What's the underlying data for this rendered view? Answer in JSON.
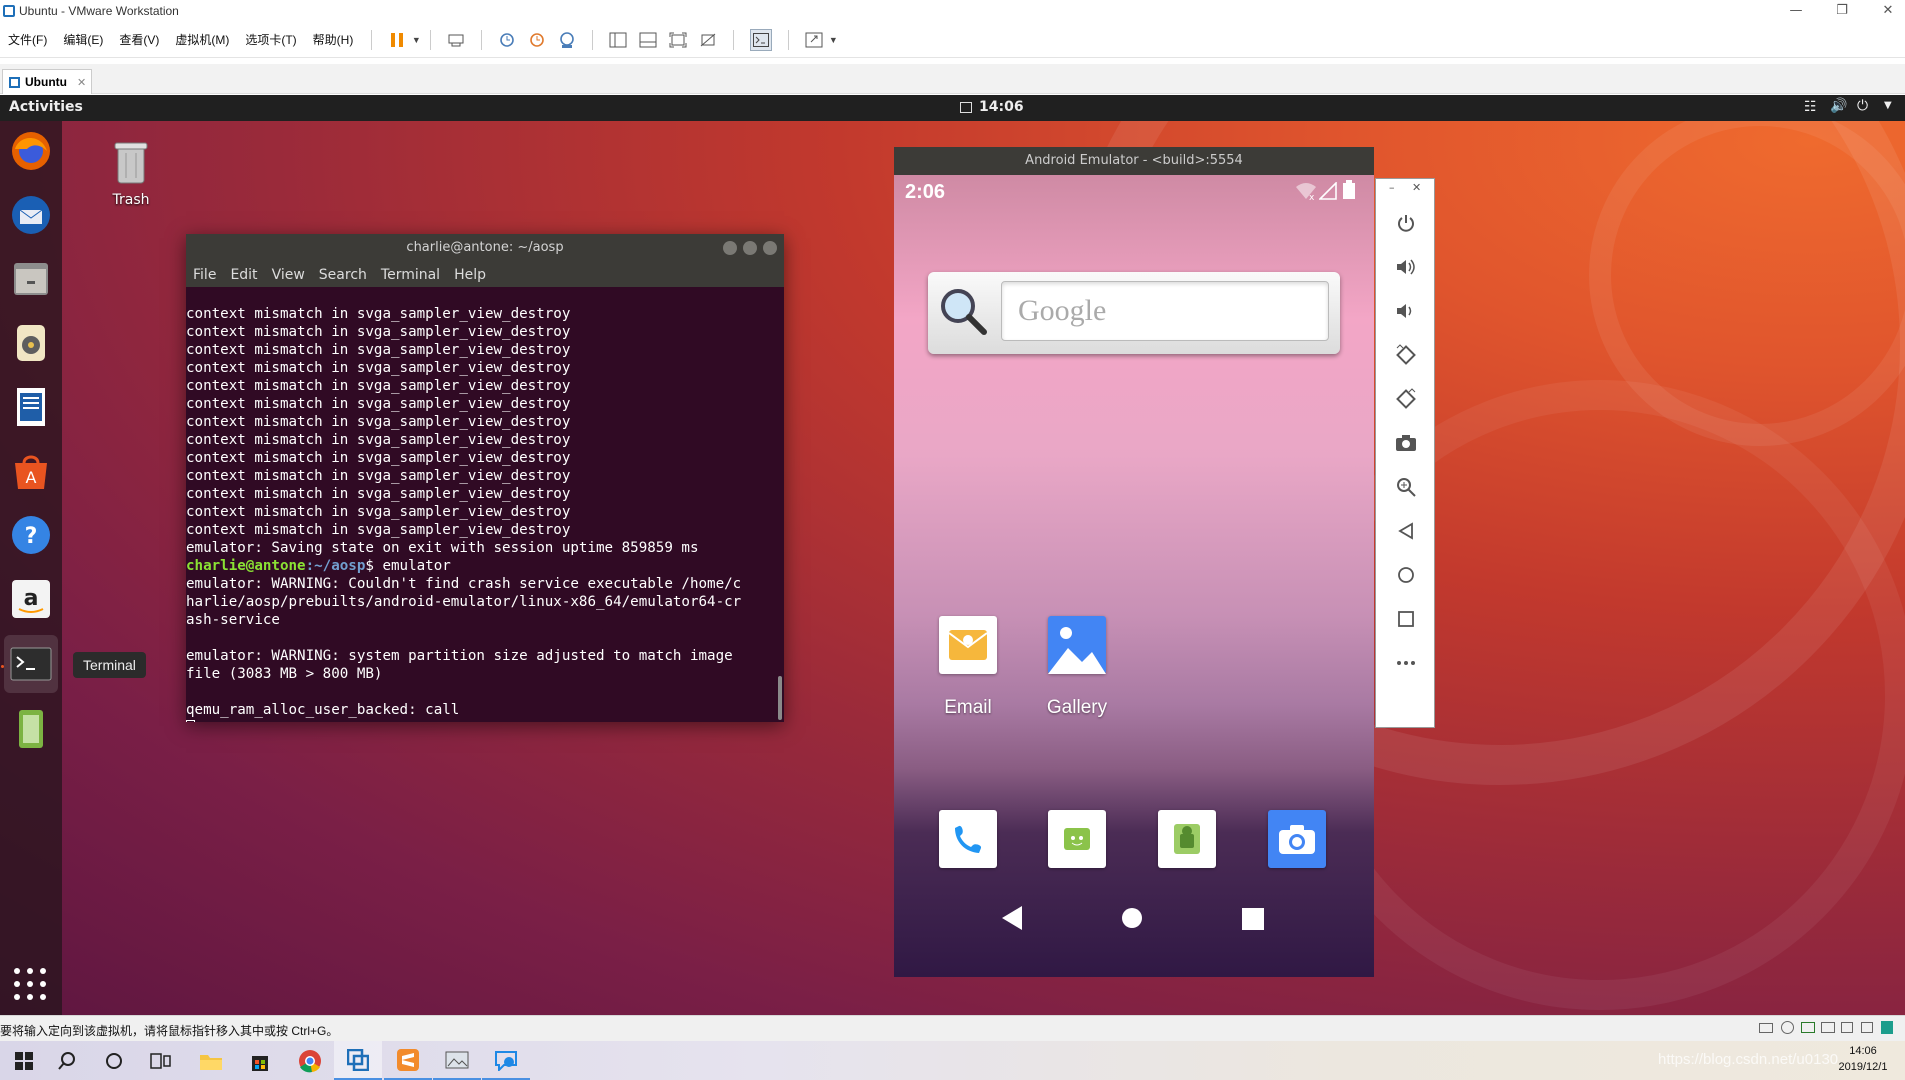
{
  "window": {
    "title": "Ubuntu - VMware Workstation",
    "menus": [
      "文件(F)",
      "编辑(E)",
      "查看(V)",
      "虚拟机(M)",
      "选项卡(T)",
      "帮助(H)"
    ],
    "tab_label": "Ubuntu"
  },
  "ubuntu": {
    "activities": "Activities",
    "clock": "14:06",
    "desktop_icon_label": "Trash",
    "dock_tooltip": "Terminal"
  },
  "terminal": {
    "title": "charlie@antone: ~/aosp",
    "menu": [
      "File",
      "Edit",
      "View",
      "Search",
      "Terminal",
      "Help"
    ],
    "lines": [
      "context mismatch in svga_sampler_view_destroy",
      "context mismatch in svga_sampler_view_destroy",
      "context mismatch in svga_sampler_view_destroy",
      "context mismatch in svga_sampler_view_destroy",
      "context mismatch in svga_sampler_view_destroy",
      "context mismatch in svga_sampler_view_destroy",
      "context mismatch in svga_sampler_view_destroy",
      "context mismatch in svga_sampler_view_destroy",
      "context mismatch in svga_sampler_view_destroy",
      "context mismatch in svga_sampler_view_destroy",
      "context mismatch in svga_sampler_view_destroy",
      "context mismatch in svga_sampler_view_destroy",
      "context mismatch in svga_sampler_view_destroy",
      "emulator: Saving state on exit with session uptime 859859 ms"
    ],
    "prompt_user": "charlie@antone",
    "prompt_path": ":~/aosp",
    "prompt_cmd": "$ emulator",
    "output": [
      "emulator: WARNING: Couldn't find crash service executable /home/c",
      "harlie/aosp/prebuilts/android-emulator/linux-x86_64/emulator64-cr",
      "ash-service",
      "",
      "emulator: WARNING: system partition size adjusted to match image",
      "file (3083 MB > 800 MB)",
      "",
      "qemu_ram_alloc_user_backed: call"
    ]
  },
  "emulator": {
    "title": "Android Emulator - <build>:5554",
    "time": "2:06",
    "search_placeholder": "Google",
    "apps": [
      {
        "label": "Email"
      },
      {
        "label": "Gallery"
      }
    ]
  },
  "vm_status": {
    "hint": "要将输入定向到该虚拟机，请将鼠标指针移入其中或按 Ctrl+G。"
  },
  "taskbar": {
    "time": "14:06",
    "date": "2019/12/1",
    "watermark": "https://blog.csdn.net/u0130"
  },
  "colors": {
    "terminal_bg": "#300a24",
    "prompt_user": "#8ae234",
    "prompt_path": "#729fcf",
    "ubuntu_orange": "#e95420"
  }
}
